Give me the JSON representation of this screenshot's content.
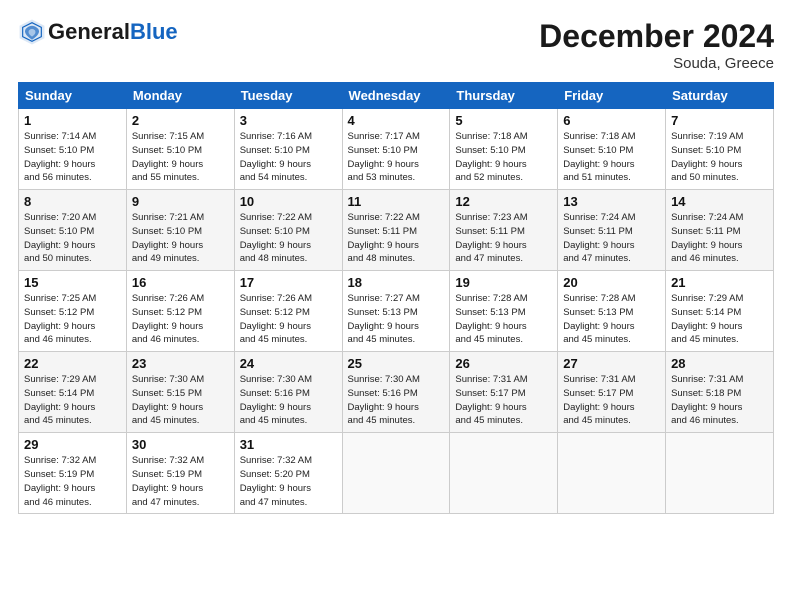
{
  "header": {
    "logo_general": "General",
    "logo_blue": "Blue",
    "month_title": "December 2024",
    "location": "Souda, Greece"
  },
  "days_of_week": [
    "Sunday",
    "Monday",
    "Tuesday",
    "Wednesday",
    "Thursday",
    "Friday",
    "Saturday"
  ],
  "weeks": [
    [
      {
        "day": 1,
        "info": "Sunrise: 7:14 AM\nSunset: 5:10 PM\nDaylight: 9 hours\nand 56 minutes."
      },
      {
        "day": 2,
        "info": "Sunrise: 7:15 AM\nSunset: 5:10 PM\nDaylight: 9 hours\nand 55 minutes."
      },
      {
        "day": 3,
        "info": "Sunrise: 7:16 AM\nSunset: 5:10 PM\nDaylight: 9 hours\nand 54 minutes."
      },
      {
        "day": 4,
        "info": "Sunrise: 7:17 AM\nSunset: 5:10 PM\nDaylight: 9 hours\nand 53 minutes."
      },
      {
        "day": 5,
        "info": "Sunrise: 7:18 AM\nSunset: 5:10 PM\nDaylight: 9 hours\nand 52 minutes."
      },
      {
        "day": 6,
        "info": "Sunrise: 7:18 AM\nSunset: 5:10 PM\nDaylight: 9 hours\nand 51 minutes."
      },
      {
        "day": 7,
        "info": "Sunrise: 7:19 AM\nSunset: 5:10 PM\nDaylight: 9 hours\nand 50 minutes."
      }
    ],
    [
      {
        "day": 8,
        "info": "Sunrise: 7:20 AM\nSunset: 5:10 PM\nDaylight: 9 hours\nand 50 minutes."
      },
      {
        "day": 9,
        "info": "Sunrise: 7:21 AM\nSunset: 5:10 PM\nDaylight: 9 hours\nand 49 minutes."
      },
      {
        "day": 10,
        "info": "Sunrise: 7:22 AM\nSunset: 5:10 PM\nDaylight: 9 hours\nand 48 minutes."
      },
      {
        "day": 11,
        "info": "Sunrise: 7:22 AM\nSunset: 5:11 PM\nDaylight: 9 hours\nand 48 minutes."
      },
      {
        "day": 12,
        "info": "Sunrise: 7:23 AM\nSunset: 5:11 PM\nDaylight: 9 hours\nand 47 minutes."
      },
      {
        "day": 13,
        "info": "Sunrise: 7:24 AM\nSunset: 5:11 PM\nDaylight: 9 hours\nand 47 minutes."
      },
      {
        "day": 14,
        "info": "Sunrise: 7:24 AM\nSunset: 5:11 PM\nDaylight: 9 hours\nand 46 minutes."
      }
    ],
    [
      {
        "day": 15,
        "info": "Sunrise: 7:25 AM\nSunset: 5:12 PM\nDaylight: 9 hours\nand 46 minutes."
      },
      {
        "day": 16,
        "info": "Sunrise: 7:26 AM\nSunset: 5:12 PM\nDaylight: 9 hours\nand 46 minutes."
      },
      {
        "day": 17,
        "info": "Sunrise: 7:26 AM\nSunset: 5:12 PM\nDaylight: 9 hours\nand 45 minutes."
      },
      {
        "day": 18,
        "info": "Sunrise: 7:27 AM\nSunset: 5:13 PM\nDaylight: 9 hours\nand 45 minutes."
      },
      {
        "day": 19,
        "info": "Sunrise: 7:28 AM\nSunset: 5:13 PM\nDaylight: 9 hours\nand 45 minutes."
      },
      {
        "day": 20,
        "info": "Sunrise: 7:28 AM\nSunset: 5:13 PM\nDaylight: 9 hours\nand 45 minutes."
      },
      {
        "day": 21,
        "info": "Sunrise: 7:29 AM\nSunset: 5:14 PM\nDaylight: 9 hours\nand 45 minutes."
      }
    ],
    [
      {
        "day": 22,
        "info": "Sunrise: 7:29 AM\nSunset: 5:14 PM\nDaylight: 9 hours\nand 45 minutes."
      },
      {
        "day": 23,
        "info": "Sunrise: 7:30 AM\nSunset: 5:15 PM\nDaylight: 9 hours\nand 45 minutes."
      },
      {
        "day": 24,
        "info": "Sunrise: 7:30 AM\nSunset: 5:16 PM\nDaylight: 9 hours\nand 45 minutes."
      },
      {
        "day": 25,
        "info": "Sunrise: 7:30 AM\nSunset: 5:16 PM\nDaylight: 9 hours\nand 45 minutes."
      },
      {
        "day": 26,
        "info": "Sunrise: 7:31 AM\nSunset: 5:17 PM\nDaylight: 9 hours\nand 45 minutes."
      },
      {
        "day": 27,
        "info": "Sunrise: 7:31 AM\nSunset: 5:17 PM\nDaylight: 9 hours\nand 45 minutes."
      },
      {
        "day": 28,
        "info": "Sunrise: 7:31 AM\nSunset: 5:18 PM\nDaylight: 9 hours\nand 46 minutes."
      }
    ],
    [
      {
        "day": 29,
        "info": "Sunrise: 7:32 AM\nSunset: 5:19 PM\nDaylight: 9 hours\nand 46 minutes."
      },
      {
        "day": 30,
        "info": "Sunrise: 7:32 AM\nSunset: 5:19 PM\nDaylight: 9 hours\nand 47 minutes."
      },
      {
        "day": 31,
        "info": "Sunrise: 7:32 AM\nSunset: 5:20 PM\nDaylight: 9 hours\nand 47 minutes."
      },
      null,
      null,
      null,
      null
    ]
  ]
}
